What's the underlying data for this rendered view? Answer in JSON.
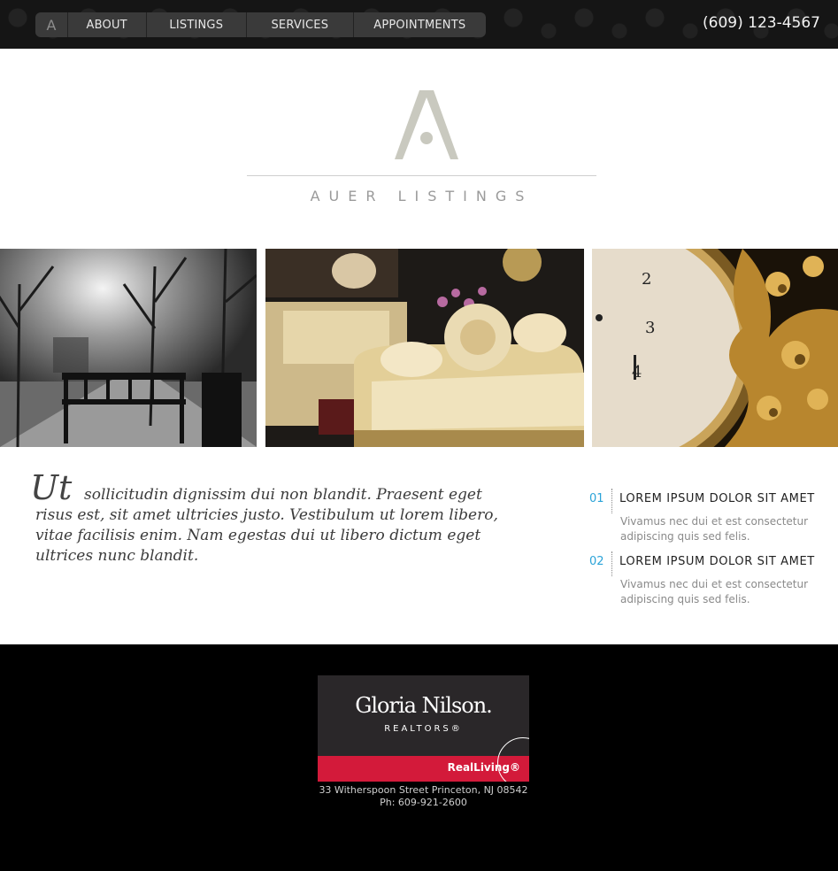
{
  "header": {
    "logo_letter": "A",
    "nav": [
      {
        "label": "ABOUT"
      },
      {
        "label": "LISTINGS"
      },
      {
        "label": "SERVICES"
      },
      {
        "label": "APPOINTMENTS"
      }
    ],
    "phone": "(609) 123-4567"
  },
  "brand": {
    "name": "AUER LISTINGS"
  },
  "gallery": [
    {
      "subject": "park bench under trees"
    },
    {
      "subject": "ornate gold sofa interior"
    },
    {
      "subject": "antique gilded clock"
    }
  ],
  "intro": {
    "dropcap": "Ut",
    "text": "sollicitudin dignissim dui non blandit. Praesent eget risus est, sit amet ultricies justo. Vestibulum ut lorem libero, vitae facilisis enim. Nam egestas dui ut libero dictum eget ultrices nunc blandit."
  },
  "features": [
    {
      "num": "01",
      "title": "LOREM IPSUM DOLOR SIT AMET",
      "text": "Vivamus nec dui et est consectetur adipiscing quis sed felis."
    },
    {
      "num": "02",
      "title": "LOREM IPSUM DOLOR SIT AMET",
      "text": "Vivamus nec dui et est consectetur adipiscing quis sed felis."
    }
  ],
  "footer": {
    "logo_name": "Gloria Nilson.",
    "logo_sub": "REALTORS®",
    "logo_brand": "RealLiving®",
    "address": "33 Witherspoon Street Princeton, NJ 08542",
    "phone": "Ph: 609-921-2600"
  },
  "colors": {
    "accent": "#2aa3d8",
    "band": "#d31a3a",
    "topbar": "#151515"
  }
}
